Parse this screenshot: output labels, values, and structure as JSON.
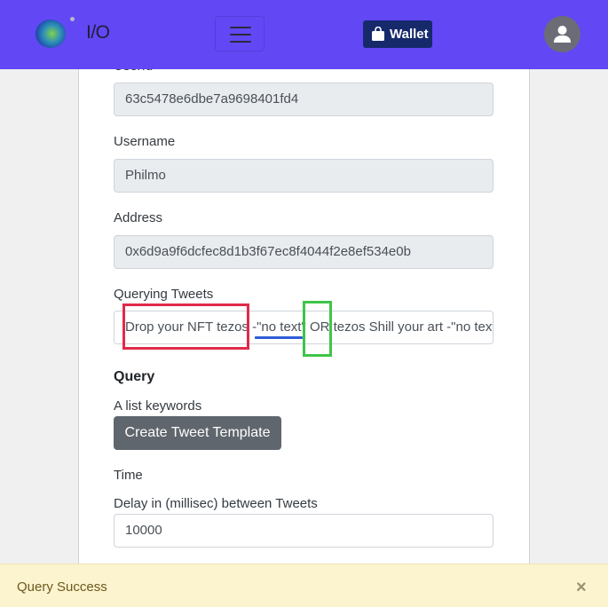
{
  "navbar": {
    "brand": "I/O",
    "wallet_label": "Wallet",
    "colors": {
      "background": "#6247f5",
      "wallet": "#16296b"
    }
  },
  "form": {
    "user_id": {
      "label": "UserId",
      "value": "63c5478e6dbe7a9698401fd4"
    },
    "username": {
      "label": "Username",
      "value": "Philmo"
    },
    "address": {
      "label": "Address",
      "value": "0x6d9a9f6dcfec8d1b3f67ec8f4044f2e8ef534e0b"
    },
    "querying_tweets": {
      "label": "Querying Tweets",
      "value": "Drop your NFT tezos -\"no text\" OR tezos Shill your art -\"no text\""
    },
    "query_heading": "Query",
    "keywords_label": "A list keywords",
    "create_template_label": "Create Tweet Template",
    "time_heading": "Time",
    "delay": {
      "label": "Delay in (millisec) between Tweets",
      "value": "10000"
    }
  },
  "annotations": {
    "colors": {
      "red": "#e02a4a",
      "green": "#3ec549",
      "blue": "#2f5bd8"
    }
  },
  "toast": {
    "message": "Query Success",
    "close_glyph": "×"
  },
  "icons": [
    "logo-icon",
    "menu-icon",
    "wallet-bag-icon",
    "user-avatar-icon",
    "close-icon"
  ]
}
